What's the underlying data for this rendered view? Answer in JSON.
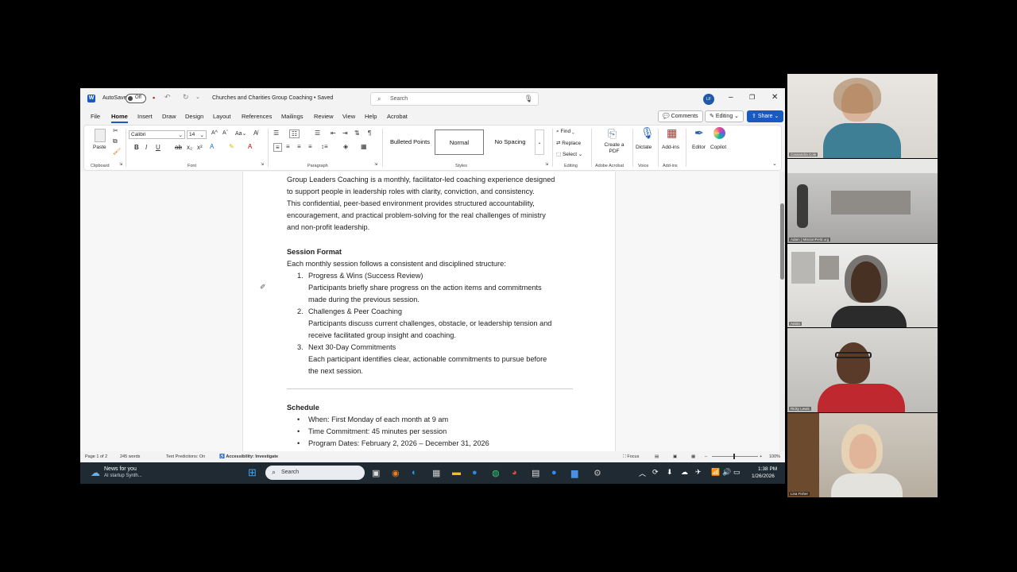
{
  "word": {
    "autosave_label": "AutoSave",
    "autosave_state": "Off",
    "doc_title": "Churches and Charities Group Coaching • Saved",
    "search_placeholder": "Search",
    "user_initials": "LF",
    "tabs": [
      "File",
      "Home",
      "Insert",
      "Draw",
      "Design",
      "Layout",
      "References",
      "Mailings",
      "Review",
      "View",
      "Help",
      "Acrobat"
    ],
    "comments_label": "Comments",
    "editing_label": "Editing",
    "share_label": "Share",
    "ribbon": {
      "paste": "Paste",
      "font_name": "Calibri",
      "font_size": "14",
      "styles": [
        "Bulleted Points",
        "Normal",
        "No Spacing"
      ],
      "find": "Find",
      "replace": "Replace",
      "select": "Select",
      "create_pdf": "Create a PDF",
      "dictate": "Dictate",
      "addins": "Add-ins",
      "editor": "Editor",
      "copilot": "Copilot",
      "groups": [
        "Clipboard",
        "Font",
        "Paragraph",
        "Styles",
        "Editing",
        "Adobe Acrobat",
        "Voice",
        "Add-ins"
      ]
    },
    "document": {
      "intro": [
        "Group Leaders Coaching is a monthly, facilitator-led coaching experience designed",
        "to support people in leadership roles with clarity, conviction, and consistency.",
        "This confidential, peer-based environment provides structured accountability,",
        "encouragement, and practical problem-solving for the real challenges of ministry",
        "and non-profit leadership."
      ],
      "session_heading": "Session Format",
      "session_intro": "Each monthly session follows a consistent and disciplined structure:",
      "items": [
        {
          "num": "1.",
          "title": "Progress & Wins (Success Review)",
          "desc": [
            "Participants briefly share progress on the action items and commitments",
            "made during the previous session."
          ]
        },
        {
          "num": "2.",
          "title": "Challenges & Peer Coaching",
          "desc": [
            "Participants discuss current challenges, obstacle, or leadership tension and",
            "receive facilitated group insight and coaching."
          ]
        },
        {
          "num": "3.",
          "title": "Next 30-Day Commitments",
          "desc": [
            "Each participant identifies clear, actionable commitments to pursue before",
            "the next session."
          ]
        }
      ],
      "schedule_heading": "Schedule",
      "schedule": [
        "When: First Monday of each month at 9 am",
        "Time Commitment: 45 minutes per session",
        "Program Dates: February 2, 2026 – December 31, 2026"
      ]
    },
    "status": {
      "page": "Page 1 of 2",
      "words": "245 words",
      "predictions": "Text Predictions: On",
      "accessibility": "Accessibility: Investigate",
      "focus": "Focus",
      "zoom": "100%"
    }
  },
  "taskbar": {
    "news_title": "News for you",
    "news_sub": "AI startup Synth...",
    "search_placeholder": "Search",
    "time": "1:38 PM",
    "date": "1/26/2026"
  },
  "participants": [
    {
      "name": "Cassandra Cole"
    },
    {
      "name": "Adam | MissionField.org"
    },
    {
      "name": "Anitra"
    },
    {
      "name": "Ricky Lewis"
    },
    {
      "name": "Lisa Fisher"
    }
  ],
  "colors": {
    "word_blue": "#185abd",
    "taskbar": "#1f2a33"
  }
}
